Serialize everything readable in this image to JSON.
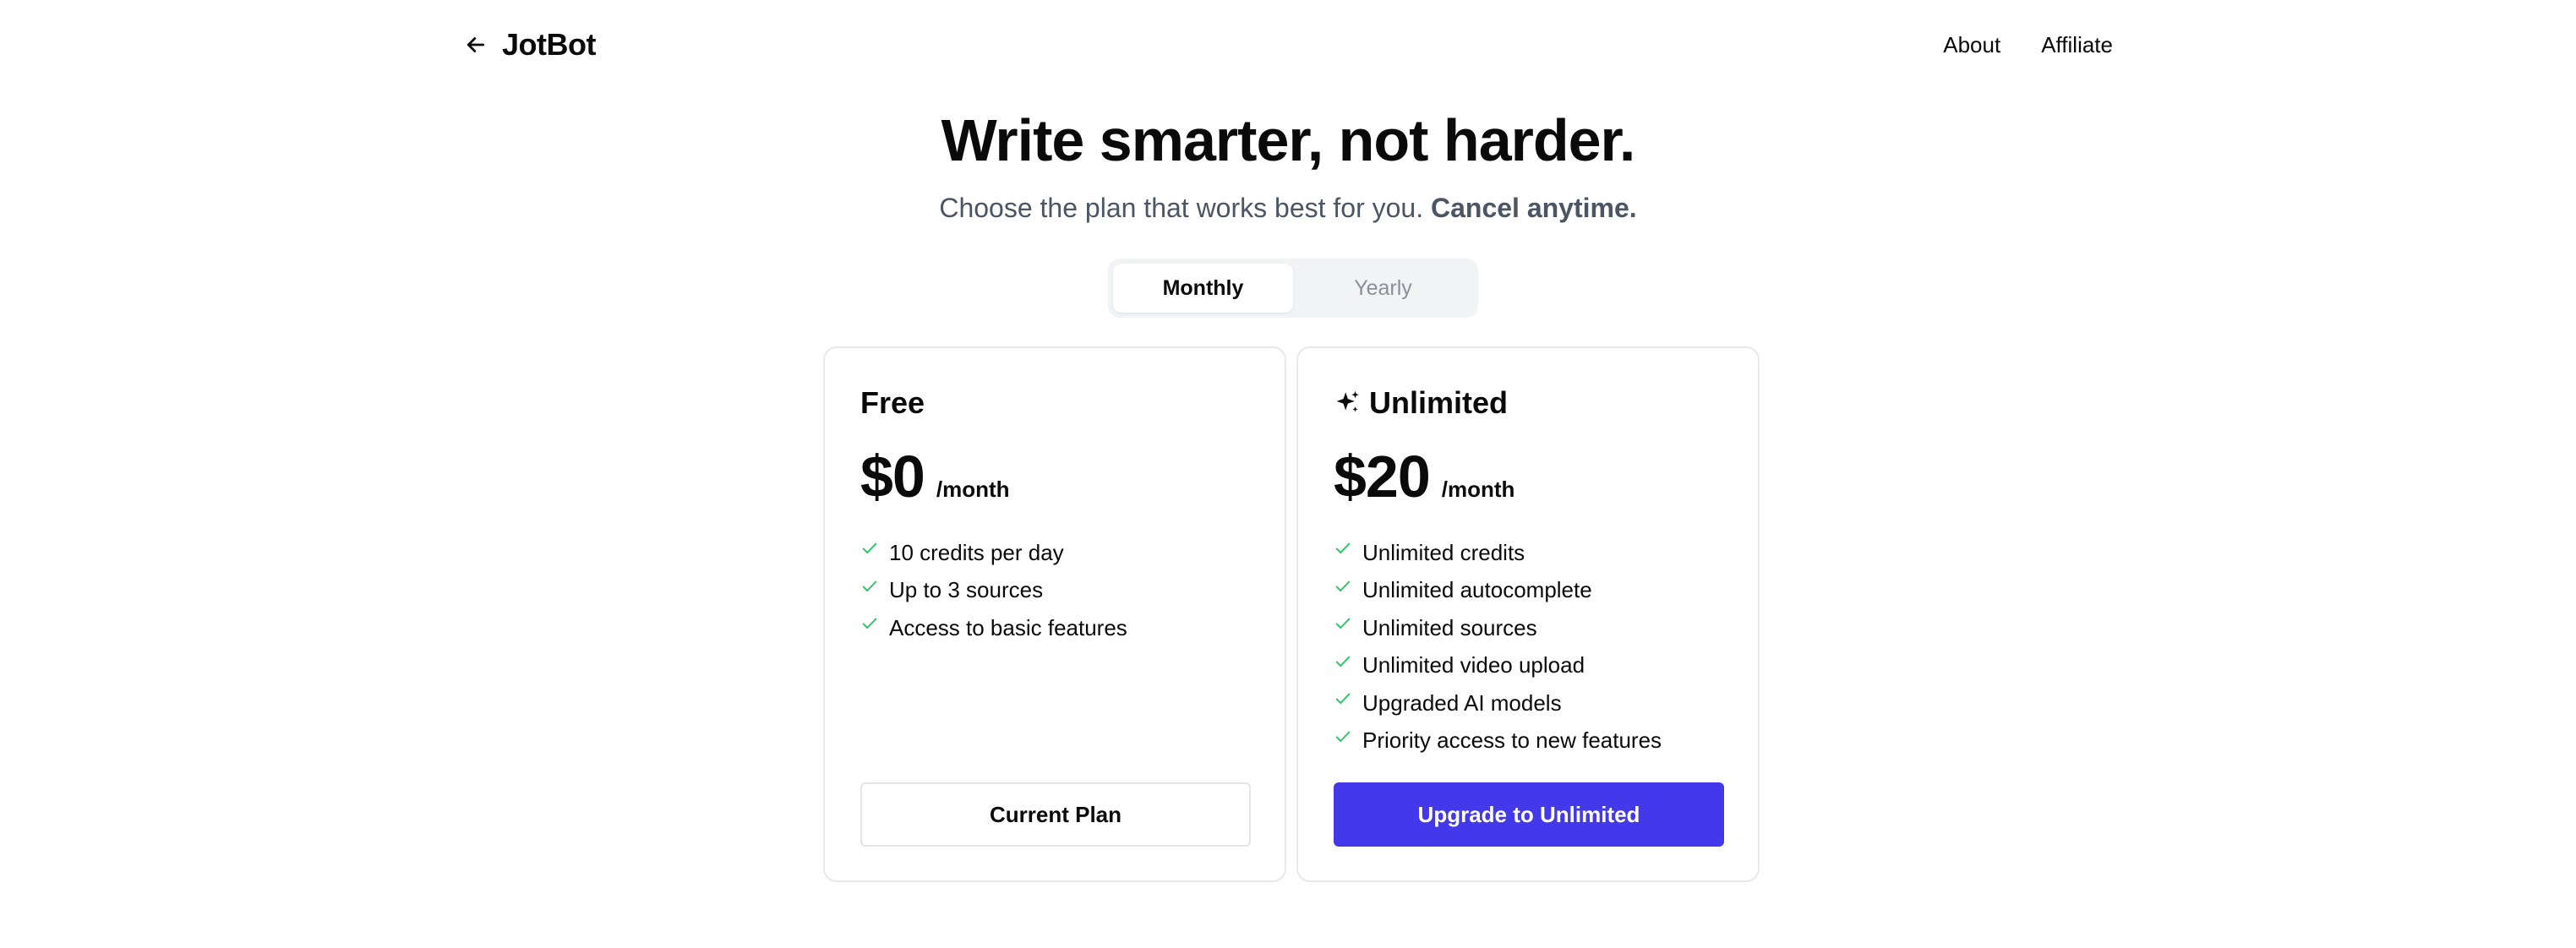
{
  "header": {
    "brand": "JotBot",
    "nav": [
      "About",
      "Affiliate"
    ]
  },
  "hero": {
    "title": "Write smarter, not harder.",
    "subtitle": "Choose the plan that works best for you.",
    "subtitle_bold": "Cancel anytime."
  },
  "billing_toggle": {
    "options": [
      "Monthly",
      "Yearly"
    ],
    "selected": "Monthly"
  },
  "plans": [
    {
      "name": "Free",
      "price": "$0",
      "period": "/month",
      "features": [
        "10 credits per day",
        "Up to 3 sources",
        "Access to basic features"
      ],
      "button": "Current Plan"
    },
    {
      "name": "Unlimited",
      "price": "$20",
      "period": "/month",
      "features": [
        "Unlimited credits",
        "Unlimited autocomplete",
        "Unlimited sources",
        "Unlimited video upload",
        "Upgraded AI models",
        "Priority access to new features"
      ],
      "button": "Upgrade to Unlimited"
    }
  ],
  "colors": {
    "accent": "#4338ea",
    "check": "#22c55e",
    "muted_text": "#4b5563"
  },
  "icons": {
    "back": "arrow-left-icon",
    "plan_badge": "sparkle-icon",
    "feature": "check-icon"
  }
}
